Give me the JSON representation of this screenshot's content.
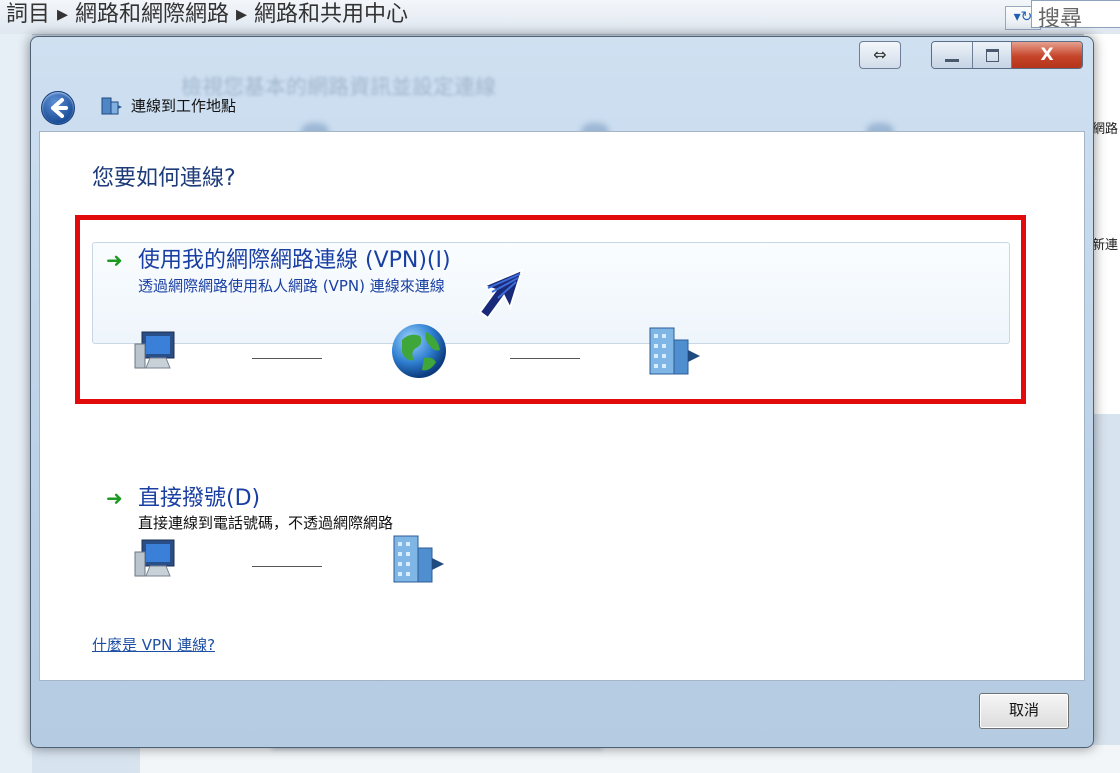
{
  "background": {
    "breadcrumb": "詞目 ▸ 網路和網際網路 ▸ 網路和共用中心",
    "search_placeholder": "搜尋",
    "right_text_1": "網路",
    "right_text_2": "新連"
  },
  "window": {
    "title": "連線到工作地點",
    "controls": {
      "switch_glyph": "⇔",
      "close_glyph": "X"
    }
  },
  "content": {
    "heading": "您要如何連線?",
    "options": [
      {
        "title": "使用我的網際網路連線 (VPN)(I)",
        "description": "透過網際網路使用私人網路 (VPN) 連線來連線",
        "selected": true
      },
      {
        "title": "直接撥號(D)",
        "description": "直接連線到電話號碼，不透過網際網路",
        "selected": false
      }
    ],
    "help_link": "什麼是 VPN 連線?"
  },
  "footer": {
    "cancel_label": "取消"
  },
  "icons": [
    "back-arrow-icon",
    "network-icon",
    "computer-icon",
    "globe-icon",
    "building-icon",
    "arrow-right-icon"
  ],
  "colors": {
    "accent": "#1a3fa3",
    "highlight": "#e20a0a",
    "arrow_green": "#1b9a22"
  }
}
